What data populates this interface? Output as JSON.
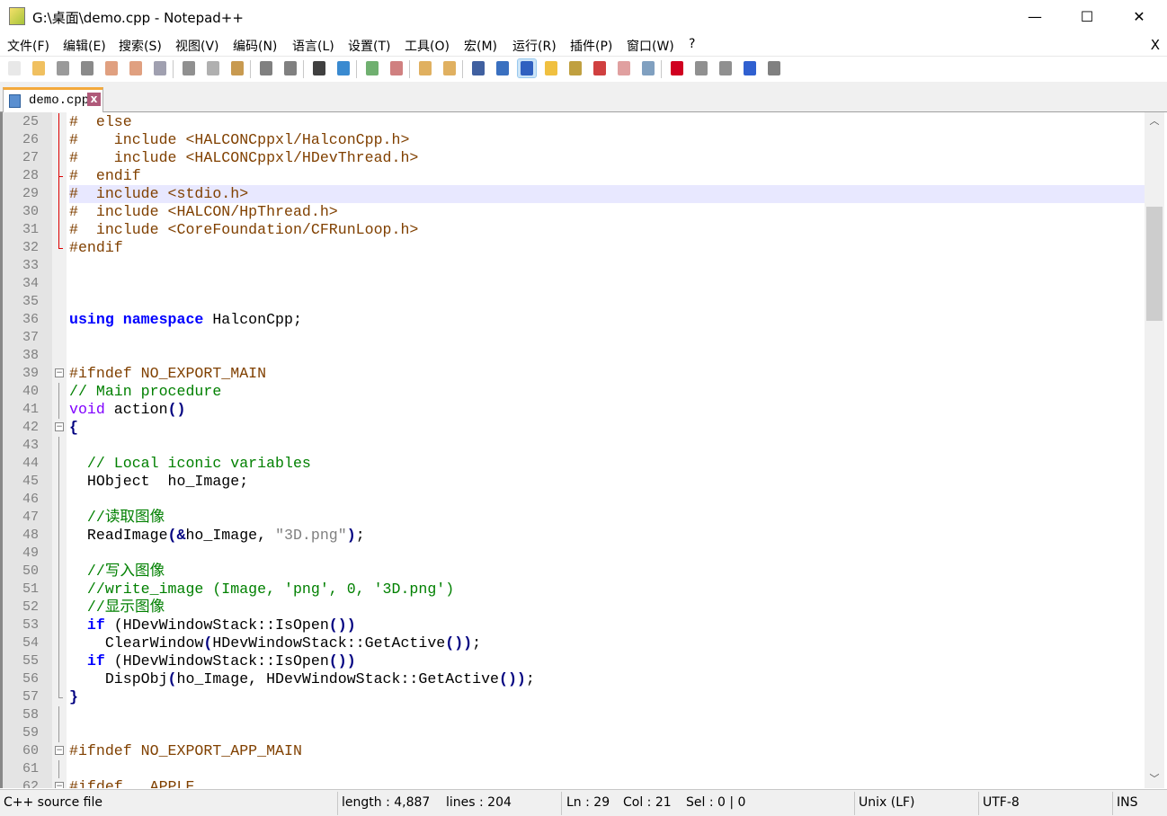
{
  "window": {
    "title": "G:\\桌面\\demo.cpp - Notepad++",
    "minimize": "—",
    "maximize": "☐",
    "close": "✕"
  },
  "menu": [
    "文件(F)",
    "编辑(E)",
    "搜索(S)",
    "视图(V)",
    "编码(N)",
    "语言(L)",
    "设置(T)",
    "工具(O)",
    "宏(M)",
    "运行(R)",
    "插件(P)",
    "窗口(W)",
    "?"
  ],
  "menu_close": "X",
  "toolbar": [
    {
      "icon": "new-file-icon",
      "color": "#e8e8e8"
    },
    {
      "icon": "open-file-icon",
      "color": "#f0c060"
    },
    {
      "icon": "save-icon",
      "color": "#9a9a9a"
    },
    {
      "icon": "save-all-icon",
      "color": "#8a8a8a"
    },
    {
      "icon": "close-icon",
      "color": "#e0a080"
    },
    {
      "icon": "close-all-icon",
      "color": "#e0a080"
    },
    {
      "icon": "print-icon",
      "color": "#a0a0b0"
    },
    {
      "icon": "cut-icon",
      "color": "#909090"
    },
    {
      "icon": "copy-icon",
      "color": "#b0b0b0"
    },
    {
      "icon": "paste-icon",
      "color": "#c89a50"
    },
    {
      "icon": "undo-icon",
      "color": "#808080"
    },
    {
      "icon": "redo-icon",
      "color": "#808080"
    },
    {
      "icon": "find-icon",
      "color": "#404040"
    },
    {
      "icon": "replace-icon",
      "color": "#3a8ad0"
    },
    {
      "icon": "zoom-in-icon",
      "color": "#70b070"
    },
    {
      "icon": "zoom-out-icon",
      "color": "#d08080"
    },
    {
      "icon": "sync-vertical-icon",
      "color": "#e0b060"
    },
    {
      "icon": "sync-horizontal-icon",
      "color": "#e0b060"
    },
    {
      "icon": "word-wrap-icon",
      "color": "#4060a0"
    },
    {
      "icon": "show-all-chars-icon",
      "color": "#3a70c0"
    },
    {
      "icon": "indent-guide-icon",
      "color": "#3060c0",
      "active": true
    },
    {
      "icon": "user-language-icon",
      "color": "#f0c040"
    },
    {
      "icon": "doc-map-icon",
      "color": "#c0a040"
    },
    {
      "icon": "function-list-icon",
      "color": "#d04040"
    },
    {
      "icon": "folder-workspace-icon",
      "color": "#e0a0a0"
    },
    {
      "icon": "monitoring-icon",
      "color": "#80a0c0"
    },
    {
      "icon": "record-macro-icon",
      "color": "#d00020"
    },
    {
      "icon": "stop-record-icon",
      "color": "#909090"
    },
    {
      "icon": "play-macro-icon",
      "color": "#909090"
    },
    {
      "icon": "run-macro-multiple-icon",
      "color": "#3060d0"
    },
    {
      "icon": "save-macro-icon",
      "color": "#808080"
    }
  ],
  "tab": {
    "label": "demo.cpp",
    "close": "x"
  },
  "current_line": 29,
  "lines": [
    {
      "n": "25",
      "fold": "red",
      "tokens": [
        [
          "p",
          "#  else"
        ]
      ]
    },
    {
      "n": "26",
      "fold": "red",
      "tokens": [
        [
          "p",
          "#    include <HALCONCppxl/HalconCpp.h>"
        ]
      ]
    },
    {
      "n": "27",
      "fold": "red",
      "tokens": [
        [
          "p",
          "#    include <HALCONCppxl/HDevThread.h>"
        ]
      ]
    },
    {
      "n": "28",
      "fold": "red tick-red",
      "tokens": [
        [
          "p",
          "#  endif"
        ]
      ]
    },
    {
      "n": "29",
      "fold": "red",
      "tokens": [
        [
          "p",
          "#  include <stdio.h>"
        ]
      ]
    },
    {
      "n": "30",
      "fold": "red",
      "tokens": [
        [
          "p",
          "#  include <HALCON/HpThread.h>"
        ]
      ]
    },
    {
      "n": "31",
      "fold": "red",
      "tokens": [
        [
          "p",
          "#  include <CoreFoundation/CFRunLoop.h>"
        ]
      ]
    },
    {
      "n": "32",
      "fold": "end-red tick-red",
      "tokens": [
        [
          "p",
          "#endif"
        ]
      ]
    },
    {
      "n": "33",
      "fold": "",
      "tokens": []
    },
    {
      "n": "34",
      "fold": "",
      "tokens": []
    },
    {
      "n": "35",
      "fold": "",
      "tokens": []
    },
    {
      "n": "36",
      "fold": "",
      "tokens": [
        [
          "k",
          "using"
        ],
        [
          "n",
          " "
        ],
        [
          "k",
          "namespace"
        ],
        [
          "n",
          " HalconCpp;"
        ]
      ]
    },
    {
      "n": "37",
      "fold": "",
      "tokens": []
    },
    {
      "n": "38",
      "fold": "",
      "tokens": []
    },
    {
      "n": "39",
      "fold": "box",
      "tokens": [
        [
          "p",
          "#ifndef NO_EXPORT_MAIN"
        ]
      ]
    },
    {
      "n": "40",
      "fold": "gray",
      "tokens": [
        [
          "c",
          "// Main procedure"
        ]
      ]
    },
    {
      "n": "41",
      "fold": "gray",
      "tokens": [
        [
          "t",
          "void"
        ],
        [
          "n",
          " action"
        ],
        [
          "o",
          "()"
        ]
      ]
    },
    {
      "n": "42",
      "fold": "box",
      "tokens": [
        [
          "o",
          "{"
        ]
      ]
    },
    {
      "n": "43",
      "fold": "gray",
      "tokens": []
    },
    {
      "n": "44",
      "fold": "gray",
      "tokens": [
        [
          "n",
          "  "
        ],
        [
          "c",
          "// Local iconic variables"
        ]
      ]
    },
    {
      "n": "45",
      "fold": "gray",
      "tokens": [
        [
          "n",
          "  HObject  ho_Image;"
        ]
      ]
    },
    {
      "n": "46",
      "fold": "gray",
      "tokens": []
    },
    {
      "n": "47",
      "fold": "gray",
      "tokens": [
        [
          "n",
          "  "
        ],
        [
          "c",
          "//读取图像"
        ]
      ]
    },
    {
      "n": "48",
      "fold": "gray",
      "tokens": [
        [
          "n",
          "  ReadImage"
        ],
        [
          "o",
          "(&"
        ],
        [
          "n",
          "ho_Image, "
        ],
        [
          "s",
          "\"3D.png\""
        ],
        [
          "o",
          ")"
        ],
        [
          "n",
          ";"
        ]
      ]
    },
    {
      "n": "49",
      "fold": "gray",
      "tokens": []
    },
    {
      "n": "50",
      "fold": "gray",
      "tokens": [
        [
          "n",
          "  "
        ],
        [
          "c",
          "//写入图像"
        ]
      ]
    },
    {
      "n": "51",
      "fold": "gray",
      "tokens": [
        [
          "n",
          "  "
        ],
        [
          "c",
          "//write_image (Image, 'png', 0, '3D.png')"
        ]
      ]
    },
    {
      "n": "52",
      "fold": "gray",
      "tokens": [
        [
          "n",
          "  "
        ],
        [
          "c",
          "//显示图像"
        ]
      ]
    },
    {
      "n": "53",
      "fold": "gray",
      "tokens": [
        [
          "n",
          "  "
        ],
        [
          "k",
          "if"
        ],
        [
          "n",
          " (HDevWindowStack::IsOpen"
        ],
        [
          "o",
          "())"
        ]
      ]
    },
    {
      "n": "54",
      "fold": "gray",
      "tokens": [
        [
          "n",
          "    ClearWindow"
        ],
        [
          "o",
          "("
        ],
        [
          "n",
          "HDevWindowStack::GetActive"
        ],
        [
          "o",
          "())"
        ],
        [
          "n",
          ";"
        ]
      ]
    },
    {
      "n": "55",
      "fold": "gray",
      "tokens": [
        [
          "n",
          "  "
        ],
        [
          "k",
          "if"
        ],
        [
          "n",
          " (HDevWindowStack::IsOpen"
        ],
        [
          "o",
          "())"
        ]
      ]
    },
    {
      "n": "56",
      "fold": "gray",
      "tokens": [
        [
          "n",
          "    DispObj"
        ],
        [
          "o",
          "("
        ],
        [
          "n",
          "ho_Image, HDevWindowStack::GetActive"
        ],
        [
          "o",
          "())"
        ],
        [
          "n",
          ";"
        ]
      ]
    },
    {
      "n": "57",
      "fold": "end-gray tick-gray",
      "tokens": [
        [
          "o",
          "}"
        ]
      ]
    },
    {
      "n": "58",
      "fold": "gray",
      "tokens": []
    },
    {
      "n": "59",
      "fold": "gray",
      "tokens": []
    },
    {
      "n": "60",
      "fold": "box",
      "tokens": [
        [
          "p",
          "#ifndef NO_EXPORT_APP_MAIN"
        ]
      ]
    },
    {
      "n": "61",
      "fold": "gray",
      "tokens": []
    },
    {
      "n": "62",
      "fold": "box",
      "tokens": [
        [
          "p",
          "#ifdef __APPLE__"
        ]
      ]
    }
  ],
  "status": {
    "file_type": "C++ source file",
    "length": "length : 4,887",
    "lines": "lines : 204",
    "ln": "Ln : 29",
    "col": "Col : 21",
    "sel": "Sel : 0 | 0",
    "eol": "Unix (LF)",
    "encoding": "UTF-8",
    "mode": "INS"
  }
}
